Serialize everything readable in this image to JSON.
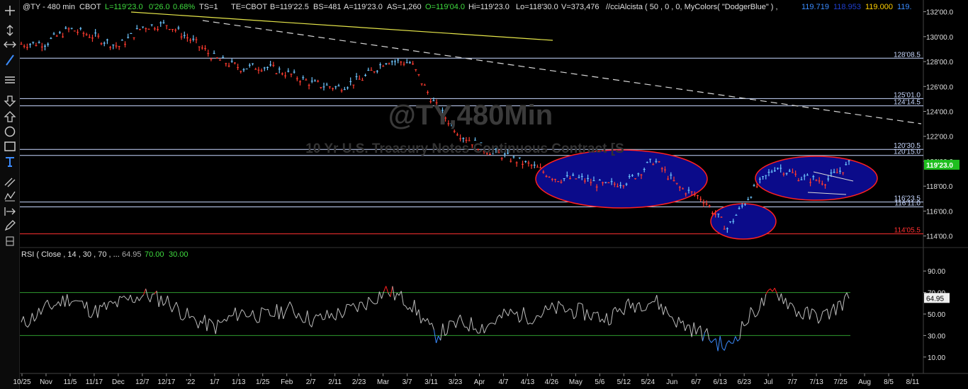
{
  "header": {
    "symbol": "@TY - 480 min",
    "exchange": "CBOT",
    "last": "L=119'23.0",
    "change": "0'26.0",
    "change_pct": "0.68%",
    "ts": "TS=1",
    "te": "TE=CBOT",
    "bid": "B=119'22.5",
    "bidsize": "BS=481",
    "ask": "A=119'23.0",
    "asksize": "AS=1,260",
    "open": "O=119'04.0",
    "high": "Hi=119'23.0",
    "low": "Lo=118'30.0",
    "volume": "V=373,476",
    "indicator": "//cciAlcista ( 50 , 0 , 0, MyColors( \"DodgerBlue\" ) ,",
    "ind_v1": "119.719",
    "ind_v2": "118.953",
    "ind_v3": "119.000",
    "ind_v4": "119."
  },
  "watermark": {
    "symbol": "@TY,480Min",
    "description": "10 Yr U.S. Treasury Notes Continuous Contract [S"
  },
  "price_axis": {
    "ticks": [
      "132'00.0",
      "130'00.0",
      "128'00.0",
      "126'00.0",
      "124'00.0",
      "122'00.0",
      "120'00.0",
      "118'00.0",
      "116'00.0",
      "114'00.0"
    ],
    "tick_values": [
      132,
      130,
      128,
      126,
      124,
      122,
      120,
      118,
      116,
      114
    ],
    "range": [
      113.3,
      132.6
    ],
    "current_label": "119'23.0",
    "current_value": 119.72
  },
  "levels": [
    {
      "label": "128'08.5",
      "value": 128.27,
      "color": "#c8d8ff"
    },
    {
      "label": "125'01.0",
      "value": 125.03,
      "color": "#c8d8ff"
    },
    {
      "label": "124'14.5",
      "value": 124.45,
      "color": "#c8d8ff"
    },
    {
      "label": "120'30.5",
      "value": 120.95,
      "color": "#c8d8ff"
    },
    {
      "label": "120'15.0",
      "value": 120.47,
      "color": "#c8d8ff"
    },
    {
      "label": "116'23.5",
      "value": 116.73,
      "color": "#c8d8ff"
    },
    {
      "label": "116'11.0",
      "value": 116.34,
      "color": "#c8d8ff"
    },
    {
      "label": "114'05.5",
      "value": 114.17,
      "color": "#ff3030"
    }
  ],
  "rsi": {
    "label": "RSI ( Close , 14 , 30 , 70 , ...",
    "value": "64.95",
    "overbought": "70.00",
    "oversold": "30.00",
    "axis_ticks": [
      "90.00",
      "70.00",
      "50.00",
      "30.00",
      "10.00"
    ],
    "tick_values": [
      90,
      70,
      50,
      30,
      10
    ],
    "range": [
      0,
      100
    ],
    "current_label": "64.95",
    "current_value": 64.95
  },
  "time_axis": {
    "labels": [
      "10/25",
      "Nov",
      "11/5",
      "11/17",
      "Dec",
      "12/7",
      "12/17",
      "'22",
      "1/7",
      "1/13",
      "1/25",
      "Feb",
      "2/7",
      "2/11",
      "2/23",
      "Mar",
      "3/7",
      "3/11",
      "3/23",
      "Apr",
      "4/7",
      "4/13",
      "4/26",
      "May",
      "5/6",
      "5/12",
      "5/24",
      "Jun",
      "6/7",
      "6/13",
      "6/23",
      "Jul",
      "7/7",
      "7/13",
      "7/25",
      "Aug",
      "8/5",
      "8/11"
    ]
  },
  "colors": {
    "up": "#6ec6ff",
    "down": "#ff3b2f",
    "ellipse_fill": "#0b0b8a",
    "ellipse_stroke": "#ff2020",
    "trend_yellow": "#e6e64a",
    "ob_line": "#2e9a2e",
    "os_line": "#2e9a2e",
    "rsi_line": "#bdbdbd",
    "rsi_low": "#3b8cff",
    "rsi_high": "#ff2020"
  },
  "chart_data": {
    "type": "line",
    "title": "@TY,480Min",
    "subtitle": "10 Yr U.S. Treasury Notes Continuous Contract [S",
    "x": [
      "10/25",
      "Nov",
      "11/5",
      "11/17",
      "Dec",
      "12/7",
      "12/17",
      "'22",
      "1/7",
      "1/13",
      "1/25",
      "Feb",
      "2/7",
      "2/11",
      "2/23",
      "Mar",
      "3/7",
      "3/11",
      "3/23",
      "Apr",
      "4/7",
      "4/13",
      "4/26",
      "May",
      "5/6",
      "5/12",
      "5/24",
      "Jun",
      "6/7",
      "6/13",
      "6/23",
      "Jul",
      "7/7",
      "7/13",
      "7/25"
    ],
    "series": [
      {
        "name": "Price",
        "values": [
          129.4,
          129.5,
          130.6,
          130.0,
          129.2,
          130.8,
          131.0,
          129.7,
          128.2,
          127.5,
          127.6,
          127.0,
          126.2,
          125.9,
          126.6,
          128.1,
          127.9,
          124.5,
          122.2,
          121.0,
          120.3,
          119.6,
          118.6,
          118.6,
          118.0,
          118.5,
          120.1,
          117.9,
          117.0,
          114.6,
          117.5,
          119.6,
          118.7,
          118.4,
          119.7
        ]
      },
      {
        "name": "RSI",
        "values": [
          40,
          55,
          65,
          52,
          60,
          68,
          62,
          45,
          38,
          52,
          48,
          55,
          44,
          50,
          58,
          72,
          60,
          30,
          42,
          38,
          50,
          48,
          55,
          52,
          46,
          58,
          63,
          42,
          32,
          18,
          50,
          72,
          50,
          48,
          65
        ]
      }
    ],
    "ylim": [
      113.3,
      132.6
    ],
    "ylim_rsi": [
      0,
      100
    ]
  }
}
